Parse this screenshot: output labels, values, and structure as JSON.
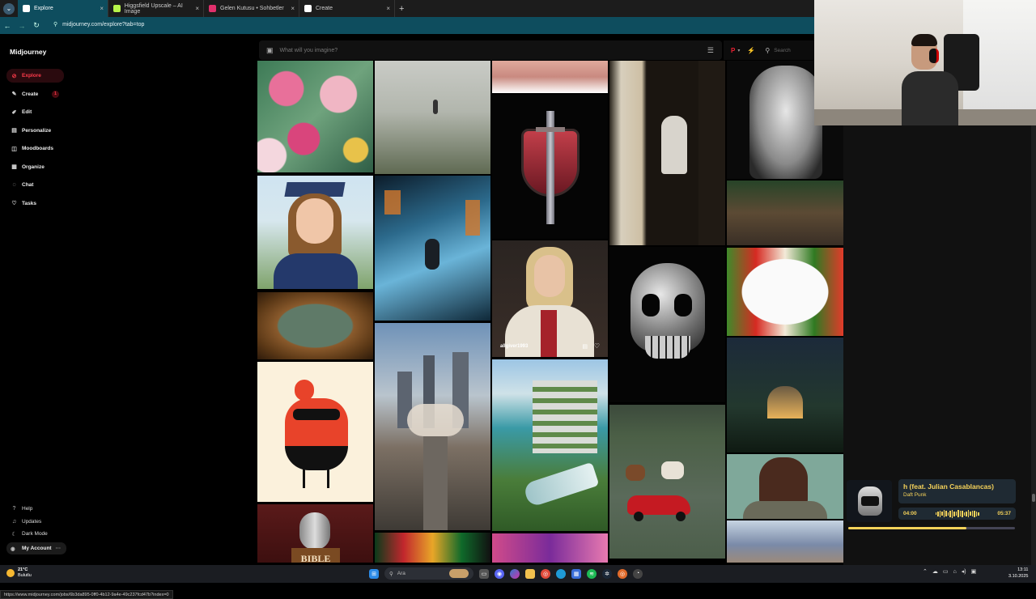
{
  "browser": {
    "tabs": [
      {
        "label": "Explore",
        "active": true,
        "favicon_color": "#ffffff"
      },
      {
        "label": "Higgsfield Upscale – AI Image",
        "active": false,
        "favicon_color": "#b7f34a"
      },
      {
        "label": "Gelen Kutusu • Sohbetler",
        "active": false,
        "favicon_color": "#e1306c"
      },
      {
        "label": "Create",
        "active": false,
        "favicon_color": "#ffffff"
      }
    ],
    "url": "midjourney.com/explore?tab=top"
  },
  "sidebar": {
    "brand": "Midjourney",
    "items": [
      {
        "label": "Explore",
        "icon": "compass-icon",
        "glyph": "⊘"
      },
      {
        "label": "Create",
        "icon": "brush-icon",
        "glyph": "✎",
        "badge": "1"
      },
      {
        "label": "Edit",
        "icon": "edit-icon",
        "glyph": "✐"
      },
      {
        "label": "Personalize",
        "icon": "personalize-icon",
        "glyph": "▤"
      },
      {
        "label": "Moodboards",
        "icon": "moodboards-icon",
        "glyph": "◫"
      },
      {
        "label": "Organize",
        "icon": "organize-icon",
        "glyph": "▦"
      },
      {
        "label": "Chat",
        "icon": "chat-icon",
        "glyph": "◌"
      },
      {
        "label": "Tasks",
        "icon": "tasks-icon",
        "glyph": "♡"
      }
    ],
    "bottom": [
      {
        "label": "Help",
        "icon": "help-icon",
        "glyph": "?"
      },
      {
        "label": "Updates",
        "icon": "bell-icon",
        "glyph": "♫"
      },
      {
        "label": "Dark Mode",
        "icon": "moon-icon",
        "glyph": "☾"
      }
    ],
    "account": "My Account",
    "status_url": "https://www.midjourney.com/jobs/6b3da895-0ff0-4b12-9a4e-49c237fcd47b?index=0"
  },
  "prompt": {
    "placeholder": "What will you imagine?"
  },
  "toolbar": {
    "search_placeholder": "Search"
  },
  "gallery": {
    "hovered_caption": "allgiver1993"
  },
  "music": {
    "song": "h (feat. Julian Casablancas)",
    "artist": "Daft Punk",
    "elapsed": "04:00",
    "total": "05:37",
    "progress": 0.71
  },
  "taskbar": {
    "temp": "21°C",
    "condition": "Bulutlu",
    "search": "Ara",
    "time": "13:11",
    "date": "3.10.2025"
  }
}
